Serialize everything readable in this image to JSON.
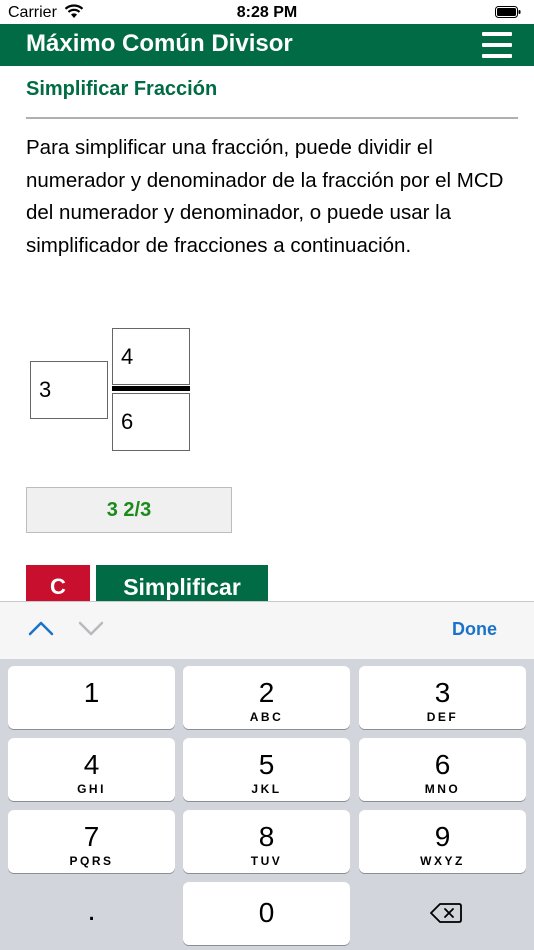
{
  "status_bar": {
    "carrier": "Carrier",
    "time": "8:28 PM"
  },
  "header": {
    "title": "Máximo Común Divisor",
    "menu_icon": "hamburger-menu-icon"
  },
  "section": {
    "title": "Simplificar Fracción",
    "description": "Para simplificar una fracción, puede dividir el numerador y denominador de la fracción por el MCD del numerador y denominador, o puede usar la simplificador de fracciones a continuación."
  },
  "fraction": {
    "whole": "3",
    "numerator": "4",
    "denominator": "6"
  },
  "result": "3 2/3",
  "buttons": {
    "clear": "C",
    "simplify": "Simplificar"
  },
  "colors": {
    "brand_green": "#006b45",
    "clear_red": "#c8102e",
    "result_green": "#1b8a1b",
    "done_blue": "#1a73c9"
  },
  "keyboard": {
    "done": "Done",
    "keys": [
      {
        "num": "1",
        "letters": ""
      },
      {
        "num": "2",
        "letters": "ABC"
      },
      {
        "num": "3",
        "letters": "DEF"
      },
      {
        "num": "4",
        "letters": "GHI"
      },
      {
        "num": "5",
        "letters": "JKL"
      },
      {
        "num": "6",
        "letters": "MNO"
      },
      {
        "num": "7",
        "letters": "PQRS"
      },
      {
        "num": "8",
        "letters": "TUV"
      },
      {
        "num": "9",
        "letters": "WXYZ"
      },
      {
        "num": ".",
        "letters": ""
      },
      {
        "num": "0",
        "letters": ""
      }
    ]
  }
}
